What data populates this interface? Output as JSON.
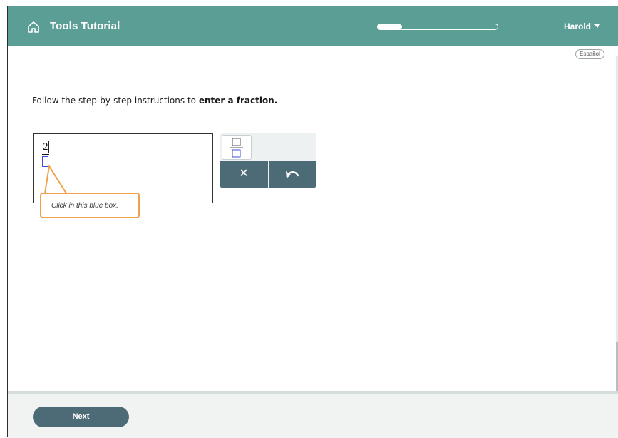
{
  "header": {
    "title": "Tools Tutorial",
    "user_name": "Harold",
    "progress_fraction": 0.2,
    "colors": {
      "bar": "#5a9e95",
      "accent": "#4d6b76",
      "callout": "#f0a04b",
      "box": "#3d4fd8"
    }
  },
  "language_button": "Español",
  "instructions": {
    "prefix": "Follow the step-by-step instructions to ",
    "bold": "enter a fraction."
  },
  "answer": {
    "numerator": "2"
  },
  "callout": {
    "text": "Click in this blue box."
  },
  "toolbox": {
    "tools": [
      {
        "name": "fraction-icon"
      },
      {
        "name": "clear-icon",
        "glyph": "✕"
      },
      {
        "name": "undo-icon"
      }
    ]
  },
  "footer": {
    "next_label": "Next"
  }
}
